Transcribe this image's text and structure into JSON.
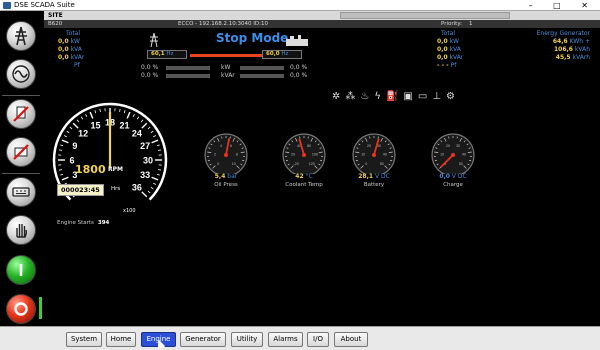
{
  "window": {
    "title": "DSE SCADA Suite",
    "controls": "–  □  ✕"
  },
  "header": {
    "site_label": "SITE",
    "module": "B620",
    "connection": "ECCO - 192.168.2.10:3040 ID:10",
    "priority_label": "Priority:",
    "priority_value": "1"
  },
  "left_totals": {
    "title": "Total",
    "rows": [
      {
        "value": "0,0",
        "unit": "kW"
      },
      {
        "value": "0,0",
        "unit": "kVA"
      },
      {
        "value": "0,0",
        "unit": "kVAr"
      },
      {
        "value": "",
        "unit": "Pf"
      }
    ]
  },
  "mode": {
    "title": "Stop Mode",
    "mains_value": "60,1",
    "mains_unit": "Hz",
    "gen_value": "60,0",
    "gen_unit": "Hz",
    "left_pct": [
      "0,0 %",
      "0,0 %"
    ],
    "right_pct": [
      "0,0 %",
      "0,0 %"
    ],
    "mid_units": [
      "kW",
      "kVAr"
    ]
  },
  "right_totals": {
    "title": "Total",
    "rows": [
      {
        "value": "0,0",
        "unit": "kW"
      },
      {
        "value": "0,0",
        "unit": "kVA"
      },
      {
        "value": "0,0",
        "unit": "kVAr"
      },
      {
        "value": "- - -",
        "unit": "Pf"
      }
    ]
  },
  "energy": {
    "title": "Energy Generator",
    "rows": [
      {
        "value": "64,6",
        "unit": "KWh +"
      },
      {
        "value": "106,6",
        "unit": "kVAh"
      },
      {
        "value": "45,5",
        "unit": "kVArh"
      }
    ]
  },
  "status_icons": [
    "cooling-fan-icon",
    "cooling-icon",
    "temperature-icon",
    "lightning-icon",
    "oil-can-icon",
    "fuel-pump-icon",
    "battery-icon",
    "coolant-level-icon",
    "engine-icon"
  ],
  "engine": {
    "rpm_value": "1800",
    "rpm_unit": "RPM",
    "rpm_fraction": 0.5,
    "tach_labels": [
      "0",
      "3",
      "6",
      "9",
      "12",
      "15",
      "18",
      "21",
      "24",
      "27",
      "30",
      "33",
      "36"
    ],
    "multiplier": "x100",
    "hours_value": "000023:45",
    "hours_unit": "Hrs",
    "starts_label": "Engine Starts",
    "starts_value": "394"
  },
  "gauges": [
    {
      "label": "Oil Press",
      "value": "5,4",
      "unit": "bar",
      "ticks": [
        "0",
        "2",
        "4",
        "6",
        "8",
        "10"
      ],
      "fraction": 0.54,
      "value_color": "#f2d24a"
    },
    {
      "label": "Coolant Temp",
      "value": "42",
      "unit": "°C",
      "ticks": [
        "-20",
        "20",
        "40",
        "80",
        "100",
        "120"
      ],
      "fraction": 0.44,
      "value_color": "#f2d24a"
    },
    {
      "label": "Battery",
      "value": "28,1",
      "unit": "V DC",
      "ticks": [
        "0",
        "10",
        "20",
        "30",
        "40",
        "50"
      ],
      "fraction": 0.56,
      "value_color": "#f2d24a"
    },
    {
      "label": "Charge",
      "value": "0,0",
      "unit": "V DC",
      "ticks": [
        "0",
        "10",
        "20",
        "30",
        "40",
        "50"
      ],
      "fraction": 0.0,
      "value_color": "#4a8ddc"
    }
  ],
  "nav": [
    {
      "label": "System"
    },
    {
      "label": "Home"
    },
    {
      "label": "Engine",
      "active": true
    },
    {
      "label": "Generator"
    },
    {
      "label": "Utility"
    },
    {
      "label": "Alarms"
    },
    {
      "label": "I/O"
    },
    {
      "label": "About"
    }
  ],
  "colors": {
    "accent": "#3c8ee8",
    "value": "#f2d24a",
    "needle": "#e8341a",
    "active_tab": "#2b4fd6"
  }
}
